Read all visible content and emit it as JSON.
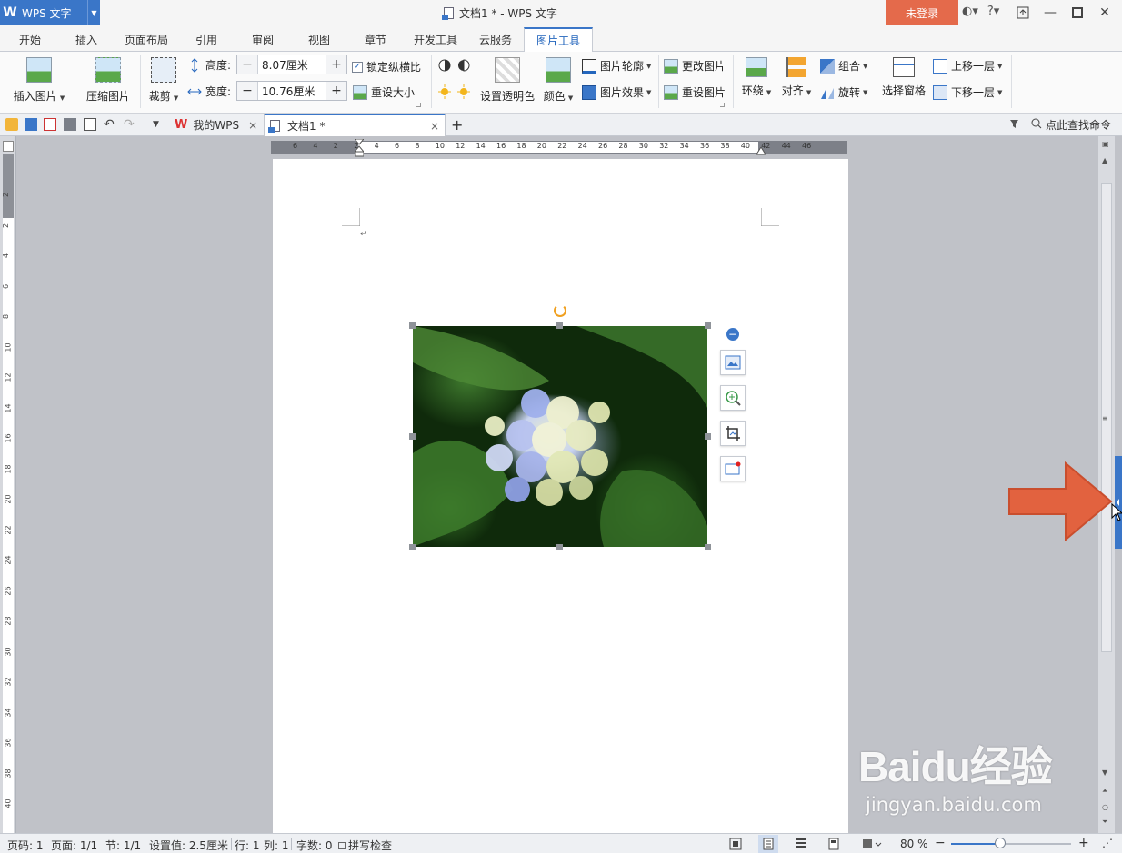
{
  "titlebar": {
    "app_name": "WPS 文字",
    "window_title": "文档1 * - WPS 文字",
    "login_label": "未登录",
    "help_label": "?"
  },
  "ribbon_tabs": [
    "开始",
    "插入",
    "页面布局",
    "引用",
    "审阅",
    "视图",
    "章节",
    "开发工具",
    "云服务",
    "图片工具"
  ],
  "active_tab": "图片工具",
  "ribbon": {
    "insert_picture": "插入图片",
    "compress_picture": "压缩图片",
    "crop": "裁剪",
    "height_label": "高度:",
    "height_value": "8.07厘米",
    "width_label": "宽度:",
    "width_value": "10.76厘米",
    "lock_ratio": "锁定纵横比",
    "lock_ratio_checked": true,
    "reset_size": "重设大小",
    "set_transparent": "设置透明色",
    "color": "颜色",
    "picture_outline": "图片轮廓",
    "picture_effect": "图片效果",
    "change_picture": "更改图片",
    "reset_picture": "重设图片",
    "wrap": "环绕",
    "align": "对齐",
    "group": "组合",
    "rotate": "旋转",
    "selection_pane": "选择窗格",
    "bring_forward": "上移一层",
    "send_backward": "下移一层"
  },
  "doc_tabs": [
    {
      "label": "我的WPS",
      "active": false
    },
    {
      "label": "文档1 *",
      "active": true
    }
  ],
  "new_tab_label": "+",
  "search_command": "点此查找命令",
  "rulers": {
    "horizontal_numbers": [
      "6",
      "4",
      "2",
      "2",
      "4",
      "6",
      "8",
      "10",
      "12",
      "14",
      "16",
      "18",
      "20",
      "22",
      "24",
      "26",
      "28",
      "30",
      "32",
      "34",
      "36",
      "38",
      "40",
      "42",
      "44",
      "46"
    ],
    "vertical_numbers": [
      "2",
      "2",
      "4",
      "6",
      "8",
      "10",
      "12",
      "14",
      "16",
      "18",
      "20",
      "22",
      "24",
      "26",
      "28",
      "30",
      "32",
      "34",
      "36",
      "38",
      "40"
    ]
  },
  "status": {
    "page_no": "页码: 1",
    "pages": "页面: 1/1",
    "section": "节: 1/1",
    "setting": "设置值: 2.5厘米",
    "line": "行: 1",
    "column": "列: 1",
    "word_count": "字数: 0",
    "spell_check": "拼写检查",
    "zoom": "80 %",
    "zoom_fraction": 0.41
  },
  "watermark": {
    "logo": "Baidu经验",
    "url": "jingyan.baidu.com"
  },
  "colors": {
    "accent": "#3a76c8",
    "login": "#e46a4b",
    "arrow": "#e2623f"
  }
}
